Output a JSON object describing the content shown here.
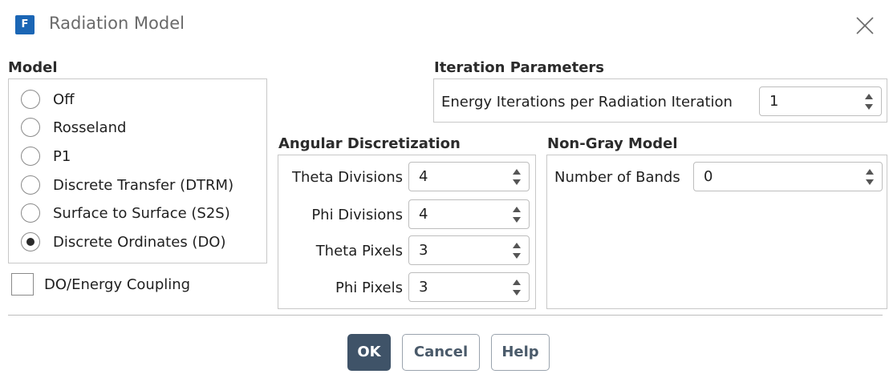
{
  "window": {
    "title": "Radiation Model",
    "app_icon_letter": "F"
  },
  "model": {
    "title": "Model",
    "options": [
      {
        "label": "Off",
        "checked": false
      },
      {
        "label": "Rosseland",
        "checked": false
      },
      {
        "label": "P1",
        "checked": false
      },
      {
        "label": "Discrete Transfer (DTRM)",
        "checked": false
      },
      {
        "label": "Surface to Surface (S2S)",
        "checked": false
      },
      {
        "label": "Discrete Ordinates (DO)",
        "checked": true
      }
    ],
    "coupling_label": "DO/Energy Coupling",
    "coupling_checked": false
  },
  "iteration": {
    "title": "Iteration Parameters",
    "energy_label": "Energy Iterations per Radiation Iteration",
    "energy_value": "1"
  },
  "angular": {
    "title": "Angular Discretization",
    "fields": [
      {
        "label": "Theta Divisions",
        "value": "4"
      },
      {
        "label": "Phi Divisions",
        "value": "4"
      },
      {
        "label": "Theta Pixels",
        "value": "3"
      },
      {
        "label": "Phi Pixels",
        "value": "3"
      }
    ]
  },
  "nongray": {
    "title": "Non-Gray Model",
    "bands_label": "Number of Bands",
    "bands_value": "0"
  },
  "buttons": {
    "ok": "OK",
    "cancel": "Cancel",
    "help": "Help"
  },
  "colors": {
    "accent": "#3f5368",
    "app_icon": "#1b66b5",
    "border": "#c8c8c8"
  }
}
